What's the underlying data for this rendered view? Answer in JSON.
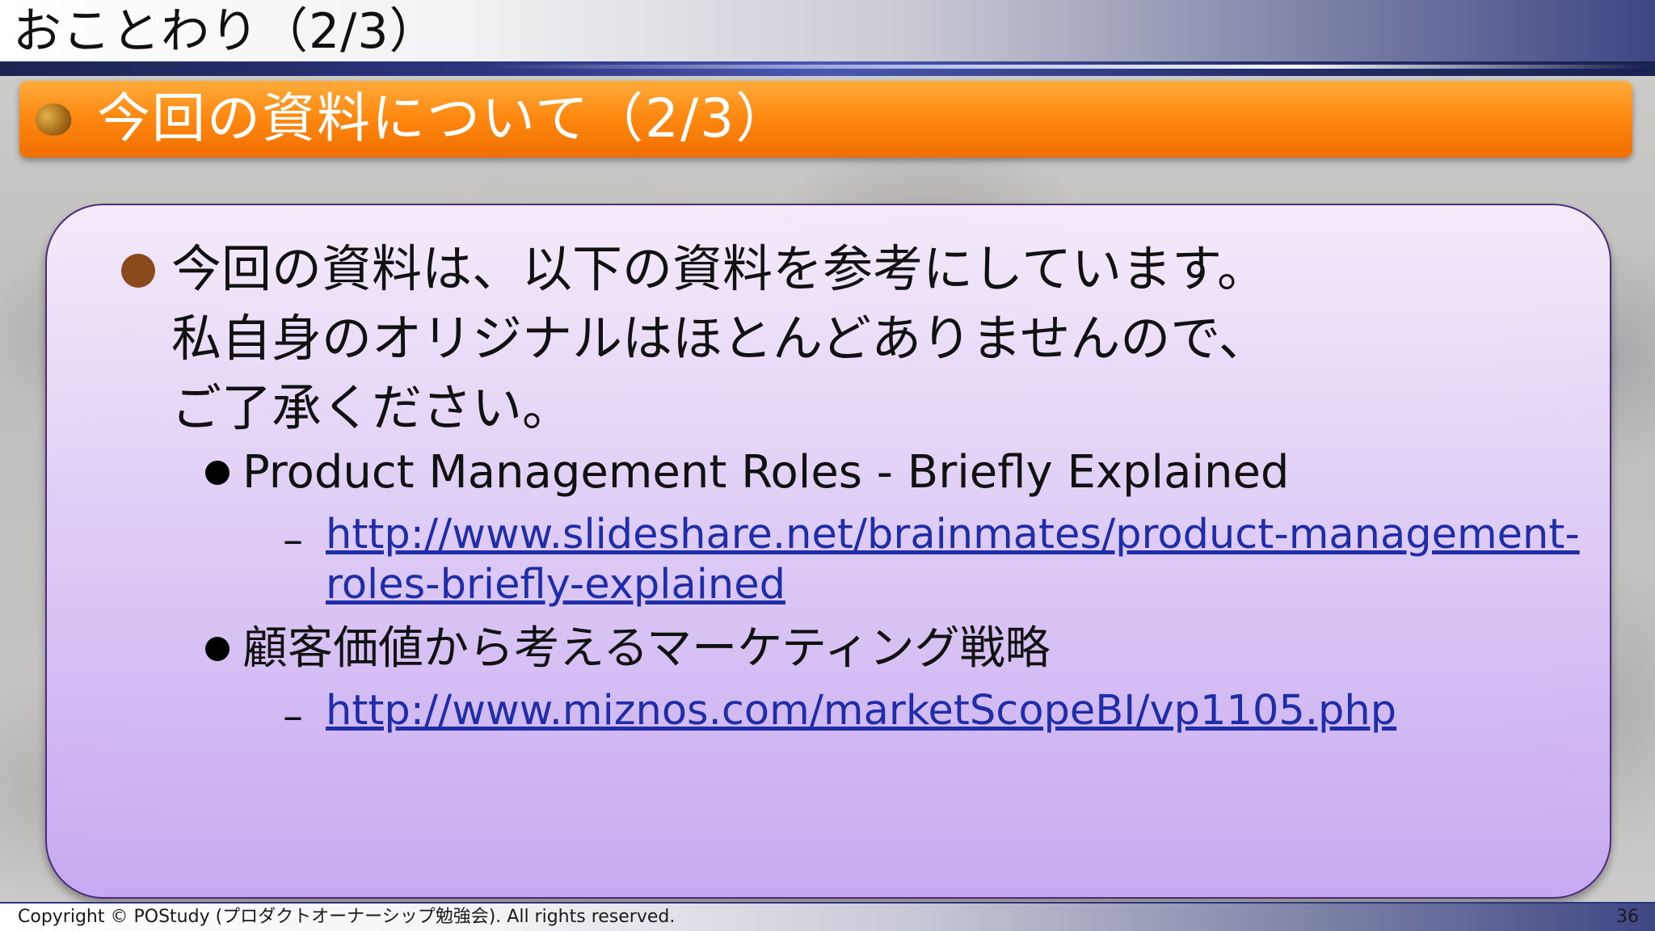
{
  "slide": {
    "title": "おことわり（2/3）",
    "section_title": "今回の資料について（2/3）",
    "body": {
      "lines": [
        "今回の資料は、以下の資料を参考にしています。",
        "私自身のオリジナルはほとんどありませんので、",
        "ご了承ください。"
      ],
      "references": [
        {
          "title": "Product Management Roles - Briefly Explained",
          "dash": "–",
          "url_lines": [
            "http://www.slideshare.net/brainmates/product-management-",
            "roles-briefly-explained"
          ]
        },
        {
          "title": "顧客価値から考えるマーケティング戦略",
          "dash": "–",
          "url_lines": [
            "http://www.miznos.com/marketScopeBI/vp1105.php"
          ]
        }
      ]
    },
    "footer": {
      "copyright": "Copyright © POStudy (プロダクトオーナーシップ勉強会).  All rights reserved.",
      "page_number": "36"
    }
  },
  "colors": {
    "header_orange": "#ff8a12",
    "content_purple": "#d8c2f6",
    "link_blue": "#1f2da8",
    "bullet_brown": "#8a4a1c"
  }
}
